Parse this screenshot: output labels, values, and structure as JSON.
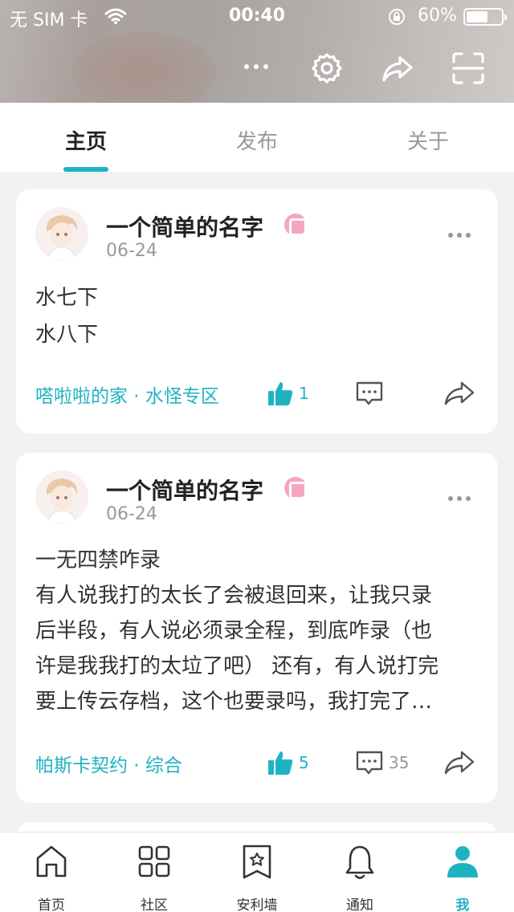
{
  "status_bar": {
    "carrier": "无 SIM 卡",
    "time": "00:40",
    "battery": "60%"
  },
  "colors": {
    "accent": "#1fb3c2",
    "level_badge": "#f6a5bf"
  },
  "header_icons": [
    "more-icon",
    "settings-icon",
    "share-icon",
    "scan-icon"
  ],
  "tabs": [
    {
      "label": "主页",
      "active": true
    },
    {
      "label": "发布",
      "active": false
    },
    {
      "label": "关于",
      "active": false
    }
  ],
  "posts": [
    {
      "author": "一个简单的名字",
      "date": "06-24",
      "lines": [
        "水七下",
        "水八下"
      ],
      "tags": "嗒啦啦的家 · 水怪专区",
      "likes": "1",
      "comments": ""
    },
    {
      "author": "一个简单的名字",
      "date": "06-24",
      "lines": [
        "一无四禁咋录",
        "有人说我打的太长了会被退回来，让我只录",
        "后半段，有人说必须录全程，到底咋录（也",
        "许是我我打的太垃了吧） 还有，有人说打完",
        "要上传云存档，这个也要录吗，我打完了…"
      ],
      "tags": "帕斯卡契约 · 综合",
      "likes": "5",
      "comments": "35"
    }
  ],
  "bottom_nav": [
    {
      "label": "首页",
      "icon": "home-icon",
      "active": false
    },
    {
      "label": "社区",
      "icon": "grid-icon",
      "active": false
    },
    {
      "label": "安利墙",
      "icon": "star-bookmark-icon",
      "active": false
    },
    {
      "label": "通知",
      "icon": "bell-icon",
      "active": false
    },
    {
      "label": "我",
      "icon": "user-icon",
      "active": true
    }
  ]
}
